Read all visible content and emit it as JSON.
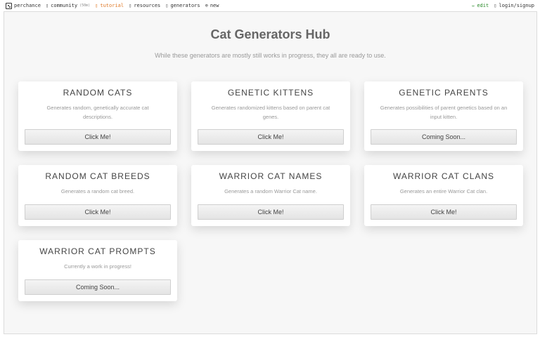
{
  "nav": {
    "left": [
      {
        "label": "perchance",
        "icon": "perchance-logo-icon"
      },
      {
        "label": "community",
        "icon": "chat-icon",
        "badge": "(50m)"
      },
      {
        "label": "tutorial",
        "icon": "book-icon"
      },
      {
        "label": "resources",
        "icon": "resources-icon"
      },
      {
        "label": "generators",
        "icon": "generators-icon"
      },
      {
        "label": "new",
        "icon": "plus-circle-icon"
      }
    ],
    "right": [
      {
        "label": "edit",
        "icon": "pencil-icon"
      },
      {
        "label": "login/signup",
        "icon": "user-icon"
      }
    ],
    "colors": {
      "tutorial": "#e07b2a",
      "edit": "#2a8a2a"
    }
  },
  "hub": {
    "title": "Cat Generators Hub",
    "subtitle": "While these generators are mostly still works in progress, they all are ready to use."
  },
  "cards": [
    {
      "title": "RANDOM CATS",
      "desc": "Generates random, genetically accurate cat descriptions.",
      "button": "Click Me!"
    },
    {
      "title": "GENETIC KITTENS",
      "desc": "Generates randomized kittens based on parent cat genes.",
      "button": "Click Me!"
    },
    {
      "title": "GENETIC PARENTS",
      "desc": "Generates possibilities of parent genetics based on an input kitten.",
      "button": "Coming Soon..."
    },
    {
      "title": "RANDOM CAT BREEDS",
      "desc": "Generates a random cat breed.",
      "button": "Click Me!"
    },
    {
      "title": "WARRIOR CAT NAMES",
      "desc": "Generates a random Warrior Cat name.",
      "button": "Click Me!"
    },
    {
      "title": "WARRIOR CAT CLANS",
      "desc": "Generates an entire Warrior Cat clan.",
      "button": "Click Me!"
    },
    {
      "title": "WARRIOR CAT PROMPTS",
      "desc": "Currently a work in progress!",
      "button": "Coming Soon..."
    }
  ]
}
